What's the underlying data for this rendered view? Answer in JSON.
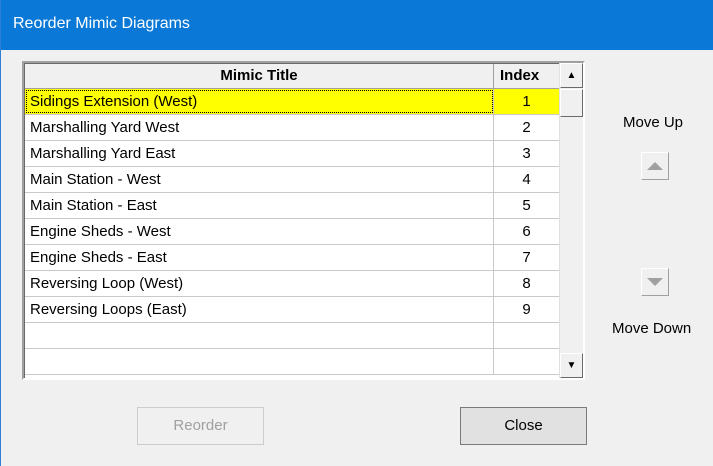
{
  "window": {
    "title": "Reorder Mimic Diagrams"
  },
  "grid": {
    "columns": [
      "Mimic Title",
      "Index"
    ],
    "rows": [
      {
        "title": "Sidings Extension (West)",
        "index": "1",
        "selected": true
      },
      {
        "title": "Marshalling Yard West",
        "index": "2"
      },
      {
        "title": "Marshalling Yard East",
        "index": "3"
      },
      {
        "title": "Main Station - West",
        "index": "4"
      },
      {
        "title": "Main Station - East",
        "index": "5"
      },
      {
        "title": "Engine Sheds - West",
        "index": "6"
      },
      {
        "title": "Engine Sheds - East",
        "index": "7"
      },
      {
        "title": "Reversing Loop (West)",
        "index": "8"
      },
      {
        "title": "Reversing Loops (East)",
        "index": "9"
      },
      {
        "title": "",
        "index": ""
      },
      {
        "title": "",
        "index": ""
      }
    ],
    "selected_color": "#ffff00"
  },
  "side": {
    "move_up_label": "Move Up",
    "move_down_label": "Move Down"
  },
  "buttons": {
    "reorder_label": "Reorder",
    "close_label": "Close"
  },
  "colors": {
    "titlebar": "#0a78d7",
    "dialog": "#f0f0f0"
  }
}
